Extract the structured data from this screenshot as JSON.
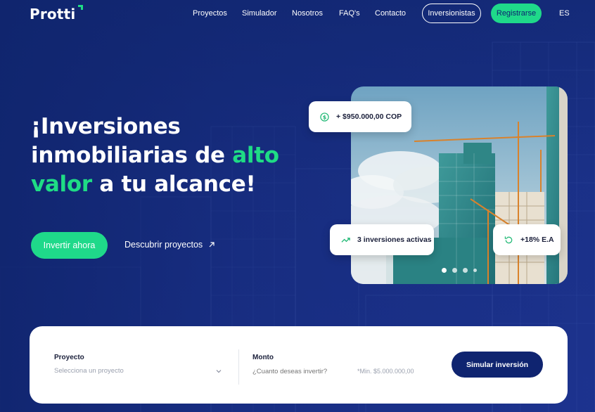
{
  "nav": {
    "logo": "Protti",
    "links": [
      "Proyectos",
      "Simulador",
      "Nosotros",
      "FAQ's",
      "Contacto"
    ],
    "investors_button": "Inversionistas",
    "register_button": "Registrarse",
    "language": "ES"
  },
  "hero": {
    "title_part1": "¡Inversiones inmobiliarias de ",
    "title_highlight1": "alto",
    "title_highlight2": "valor",
    "title_part2": " a tu alcance!",
    "cta_invest": "Invertir ahora",
    "cta_discover": "Descubrir proyectos"
  },
  "cards": {
    "amount": "+ $950.000,00 COP",
    "active": "3 inversiones activas",
    "return": "+18% E.A"
  },
  "carousel": {
    "slides": 4,
    "active_index": 0
  },
  "simulator": {
    "project_label": "Proyecto",
    "project_placeholder": "Selecciona un proyecto",
    "amount_label": "Monto",
    "amount_placeholder": "¿Cuanto deseas invertir?",
    "min_note": "*Min. $5.000.000,00",
    "simulate_button": "Simular inversión"
  },
  "colors": {
    "primary": "#10256e",
    "accent": "#1fdc85",
    "dark_button": "#0f2470"
  }
}
